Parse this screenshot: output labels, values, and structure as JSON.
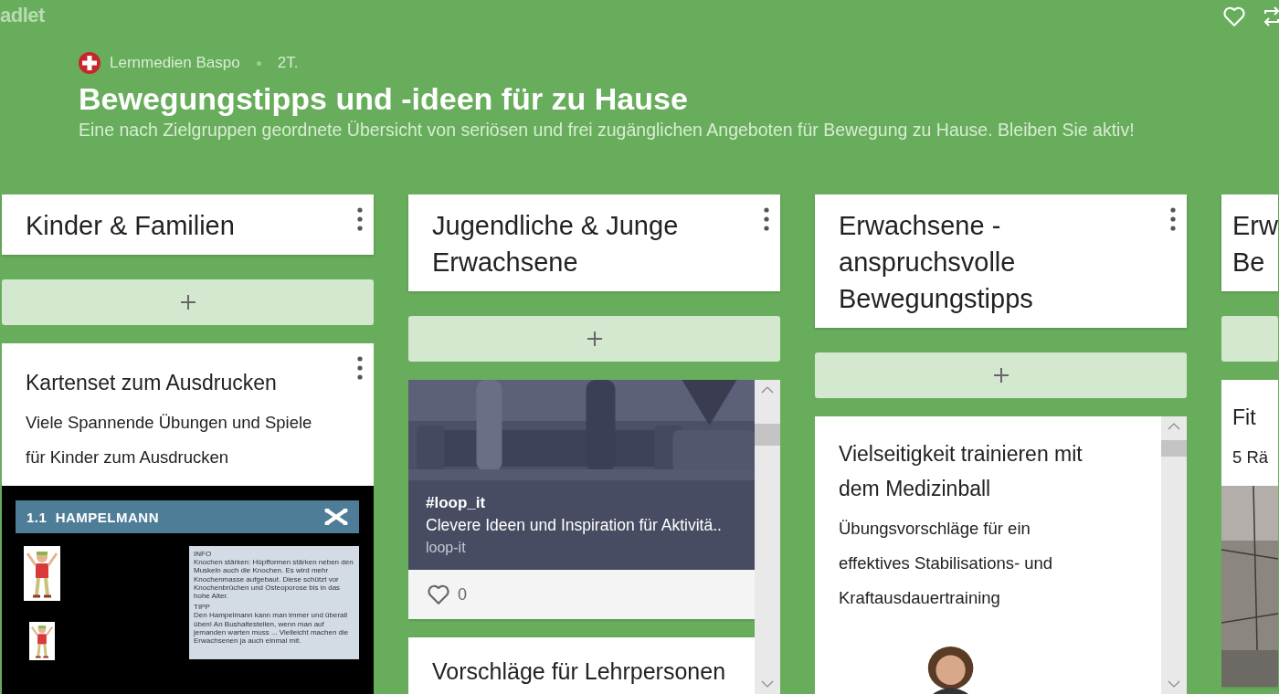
{
  "app": {
    "logo": "adlet"
  },
  "toolbar": [
    {
      "kind": "heart"
    },
    {
      "kind": "repost"
    }
  ],
  "header": {
    "author": "Lernmedien Baspo",
    "age": "2T.",
    "title": "Bewegungstipps und -ideen für zu Hause",
    "description": "Eine nach Zielgruppen geordnete Übersicht von seriösen und frei zugänglichen Angeboten für Bewegung zu Hause. Bleiben Sie aktiv!"
  },
  "columns": [
    {
      "title": "Kinder & Familien",
      "kind": "plain",
      "menu": true,
      "posts": [
        {
          "kind": "document",
          "menu": true,
          "title": "Kartenset zum Ausdrucken",
          "body": "Viele Spannende Übungen und Spiele für Kinder zum Ausdrucken",
          "doc": {
            "heading": "1.1  HAMPELMANN",
            "info_label": "INFO",
            "info": "Knochen stärken: Hüpfformen stärken neben den Muskeln auch die Knochen. Es wird mehr Knochenmasse aufgebaut. Diese schützt vor Knochenbrüchen und Osteoporose bis in das hohe Alter.",
            "tip_label": "TIPP",
            "tip": "Den Hampelmann kann man immer und überall üben! An Bushaltestellen, wenn man auf jemanden warten muss ... Vielleicht machen die Erwachsenen ja auch einmal mit."
          }
        }
      ]
    },
    {
      "title": "Jugendliche & Junge Erwachsene",
      "kind": "scroll",
      "menu": true,
      "posts": [
        {
          "kind": "link",
          "link_title": "#loop_it",
          "link_text": "Clevere Ideen und Inspiration für Aktivitä..",
          "link_source": "loop-it",
          "likes": "0"
        },
        {
          "kind": "text",
          "title": "Vorschläge für Lehrpersonen"
        }
      ]
    },
    {
      "title": "Erwachsene  - anspruchsvolle Bewegungstipps",
      "kind": "scroll",
      "menu": true,
      "posts": [
        {
          "kind": "article",
          "title": "Vielseitigkeit trainieren mit dem Medizinball",
          "body": "Übungsvorschläge für ein effektives Stabilisations- und Kraftausdauertraining"
        }
      ]
    },
    {
      "title": "Erw Be",
      "kind": "edge",
      "menu": false,
      "posts": [
        {
          "kind": "article",
          "title": "Fit",
          "body": "5 Rä"
        }
      ]
    }
  ]
}
